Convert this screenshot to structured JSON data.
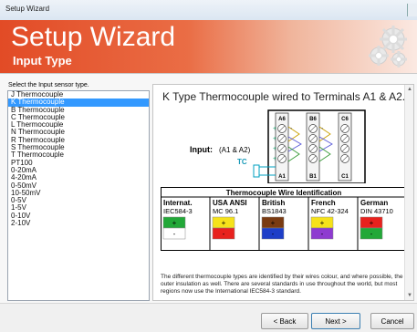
{
  "window": {
    "title": "Setup Wizard"
  },
  "header": {
    "title": "Setup Wizard",
    "subtitle": "Input Type"
  },
  "list": {
    "label": "Select the Input sensor type.",
    "items": [
      "J Thermocouple",
      "K Thermocouple",
      "B Thermocouple",
      "C Thermocouple",
      "L Thermocouple",
      "N Thermocouple",
      "R Thermocouple",
      "S Thermocouple",
      "T Thermocouple",
      "PT100",
      "0-20mA",
      "4-20mA",
      "0-50mV",
      "10-50mV",
      "0-5V",
      "1-5V",
      "0-10V",
      "2-10V"
    ],
    "selected_index": 1
  },
  "content": {
    "title": "K Type Thermocouple wired to Terminals A1 & A2.",
    "diagram": {
      "input_label": "Input:",
      "input_terms": "(A1 & A2)",
      "tc_label": "TC",
      "col_top": [
        "A6",
        "B6",
        "C6"
      ],
      "col_bottom": [
        "A1",
        "B1",
        "C1"
      ],
      "plus": "+",
      "minus": "-"
    },
    "table": {
      "title": "Thermocouple Wire Identification",
      "columns": [
        {
          "name": "Internat.",
          "std": "IEC584-3",
          "plus_color": "#22a838",
          "minus_color": "#ffffff"
        },
        {
          "name": "USA ANSI",
          "std": "MC 96.1",
          "plus_color": "#f6e21a",
          "minus_color": "#e8221e"
        },
        {
          "name": "British",
          "std": "BS1843",
          "plus_color": "#7a3b12",
          "minus_color": "#1e3ec8"
        },
        {
          "name": "French",
          "std": "NFC 42-324",
          "plus_color": "#f6e21a",
          "minus_color": "#8e3bd0"
        },
        {
          "name": "German",
          "std": "DIN 43710",
          "plus_color": "#e8221e",
          "minus_color": "#22a838"
        }
      ]
    },
    "description": "The different thermocouple types are identified by their wires colour, and where possible, the outer insulation as well. There are several standards in use throughout the world, but most regions now use the International IEC584-3 standard."
  },
  "buttons": {
    "back": "< Back",
    "next": "Next >",
    "cancel": "Cancel"
  }
}
